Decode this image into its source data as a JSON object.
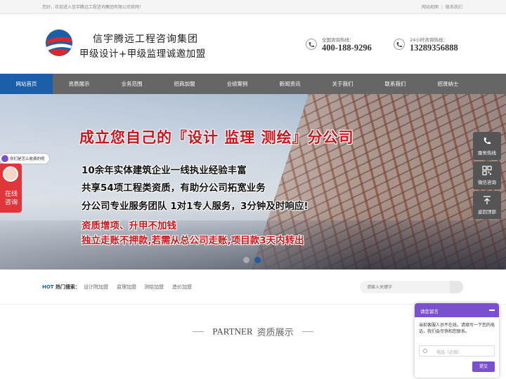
{
  "topbar": {
    "welcome": "您好，欢迎进入信宇腾远工程咨询集团有限公司官网！",
    "links": [
      "网站地图",
      "联系我们"
    ]
  },
  "header": {
    "brand_name": "信宇腾远工程咨询集团",
    "slogan": "甲级设计+甲级监理诚邀加盟",
    "hotlines": [
      {
        "label": "全国咨询热线：",
        "number": "400-188-9296"
      },
      {
        "label": "24小时咨询热线：",
        "number": "13289356888"
      }
    ]
  },
  "nav": {
    "items": [
      "网站首页",
      "资质展示",
      "业务范围",
      "招商加盟",
      "业绩案例",
      "新闻资讯",
      "关于我们",
      "联系我们",
      "招贤纳士"
    ],
    "active_index": 0
  },
  "banner": {
    "title": "成立您自己的『设计 监理 测绘』分公司",
    "lines": [
      "10余年实体建筑企业一线执业经验丰富",
      "共享54项工程类资质，有助分公司拓宽业务",
      "分公司专业服务团队 1对1专人服务，3分钟及时响应!"
    ],
    "red_lines": [
      "资质增项、升甲不加钱",
      "独立走账不押款,若需从总公司走账,项目款3天内转出"
    ],
    "active_slide": 1
  },
  "float_chat": {
    "question": "你们是怎么收费的呢",
    "online_label": "在线咨询"
  },
  "side_tools": [
    {
      "icon": "phone-icon",
      "label": "服务热线"
    },
    {
      "icon": "qrcode-icon",
      "label": "微信咨询"
    },
    {
      "icon": "arrow-up-icon",
      "label": "返回顶部"
    }
  ],
  "search": {
    "hot_prefix": "HOT",
    "hot_label": "热门搜索：",
    "keywords": [
      "设计院加盟",
      "监理加盟",
      "测绘加盟",
      "造价加盟"
    ],
    "placeholder": "请输入关键字"
  },
  "section": {
    "en": "PARTNER",
    "cn": "资质展示"
  },
  "chat_panel": {
    "title": "请您留言",
    "message": "当前客服人员不在线，请填写一下您的电话，我们会尽快和您联系。",
    "input_placeholder": "电话（必填）",
    "submit": "提交"
  },
  "colors": {
    "accent_blue": "#1a5fa8",
    "nav_gray": "#666666",
    "banner_red": "#d0141a",
    "chat_purple": "#7a4fd0"
  }
}
